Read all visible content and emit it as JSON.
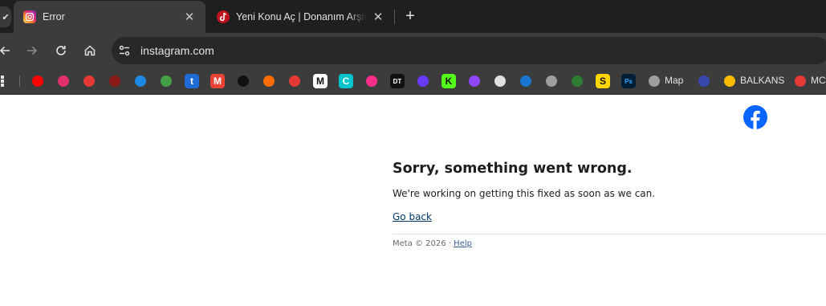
{
  "tabs": [
    {
      "title": "Error",
      "favicon": "instagram-icon",
      "active": true
    },
    {
      "title": "Yeni Konu Aç | Donanım Arşivi Forum",
      "favicon": "donanim-arsivi-icon",
      "active": false
    }
  ],
  "address_bar": {
    "url": "instagram.com"
  },
  "bookmarks": [
    {
      "icon": "youtube-icon",
      "color": "#ff0000"
    },
    {
      "icon": "instagram-icon",
      "color": "#e1306c"
    },
    {
      "icon": "download-icon",
      "color": "#e53935"
    },
    {
      "icon": "tiktok-icon",
      "color": "#8b1a1a"
    },
    {
      "icon": "edge-icon",
      "color": "#1e88e5"
    },
    {
      "icon": "power-icon",
      "color": "#43a047"
    },
    {
      "icon": "tumblr-icon",
      "color": "#1e6bd6",
      "glyph": "t"
    },
    {
      "icon": "gmail-icon",
      "color": "#ea4335",
      "glyph": "M"
    },
    {
      "icon": "editor-icon",
      "color": "#111111"
    },
    {
      "icon": "dots-icon",
      "color": "#ff6d00"
    },
    {
      "icon": "circle-red-icon",
      "color": "#e53935"
    },
    {
      "icon": "m-icon",
      "color": "#ffffff",
      "glyph": "M"
    },
    {
      "icon": "canva-icon",
      "color": "#00c4cc",
      "glyph": "C"
    },
    {
      "icon": "cube-icon",
      "color": "#ff2d8a"
    },
    {
      "icon": "text-icon",
      "color": "#111111",
      "glyph": "DT"
    },
    {
      "icon": "hex-icon",
      "color": "#6c3aff"
    },
    {
      "icon": "kick-icon",
      "color": "#53fc18",
      "glyph": "K"
    },
    {
      "icon": "twitch-icon",
      "color": "#9146ff"
    },
    {
      "icon": "database-icon",
      "color": "#e0e0e0"
    },
    {
      "icon": "box-icon",
      "color": "#1976d2"
    },
    {
      "icon": "globe-icon",
      "color": "#9e9e9e"
    },
    {
      "icon": "plant-icon",
      "color": "#2e7d32"
    },
    {
      "icon": "s-icon",
      "color": "#ffd600",
      "glyph": "S"
    },
    {
      "icon": "photoshop-icon",
      "color": "#001e36",
      "glyph": "Ps"
    },
    {
      "icon": "map-globe-icon",
      "color": "#9e9e9e",
      "label": "Map"
    },
    {
      "icon": "planet-icon",
      "color": "#3949ab"
    },
    {
      "icon": "drive-icon",
      "color": "#fbbc04",
      "label": "BALKANS"
    },
    {
      "icon": "mods-icon",
      "color": "#e53935",
      "label": "MC"
    }
  ],
  "page": {
    "error_title": "Sorry, something went wrong.",
    "error_message": "We're working on getting this fixed as soon as we can.",
    "go_back": "Go back",
    "footer_text": "Meta © 2026 · ",
    "footer_help": "Help"
  }
}
